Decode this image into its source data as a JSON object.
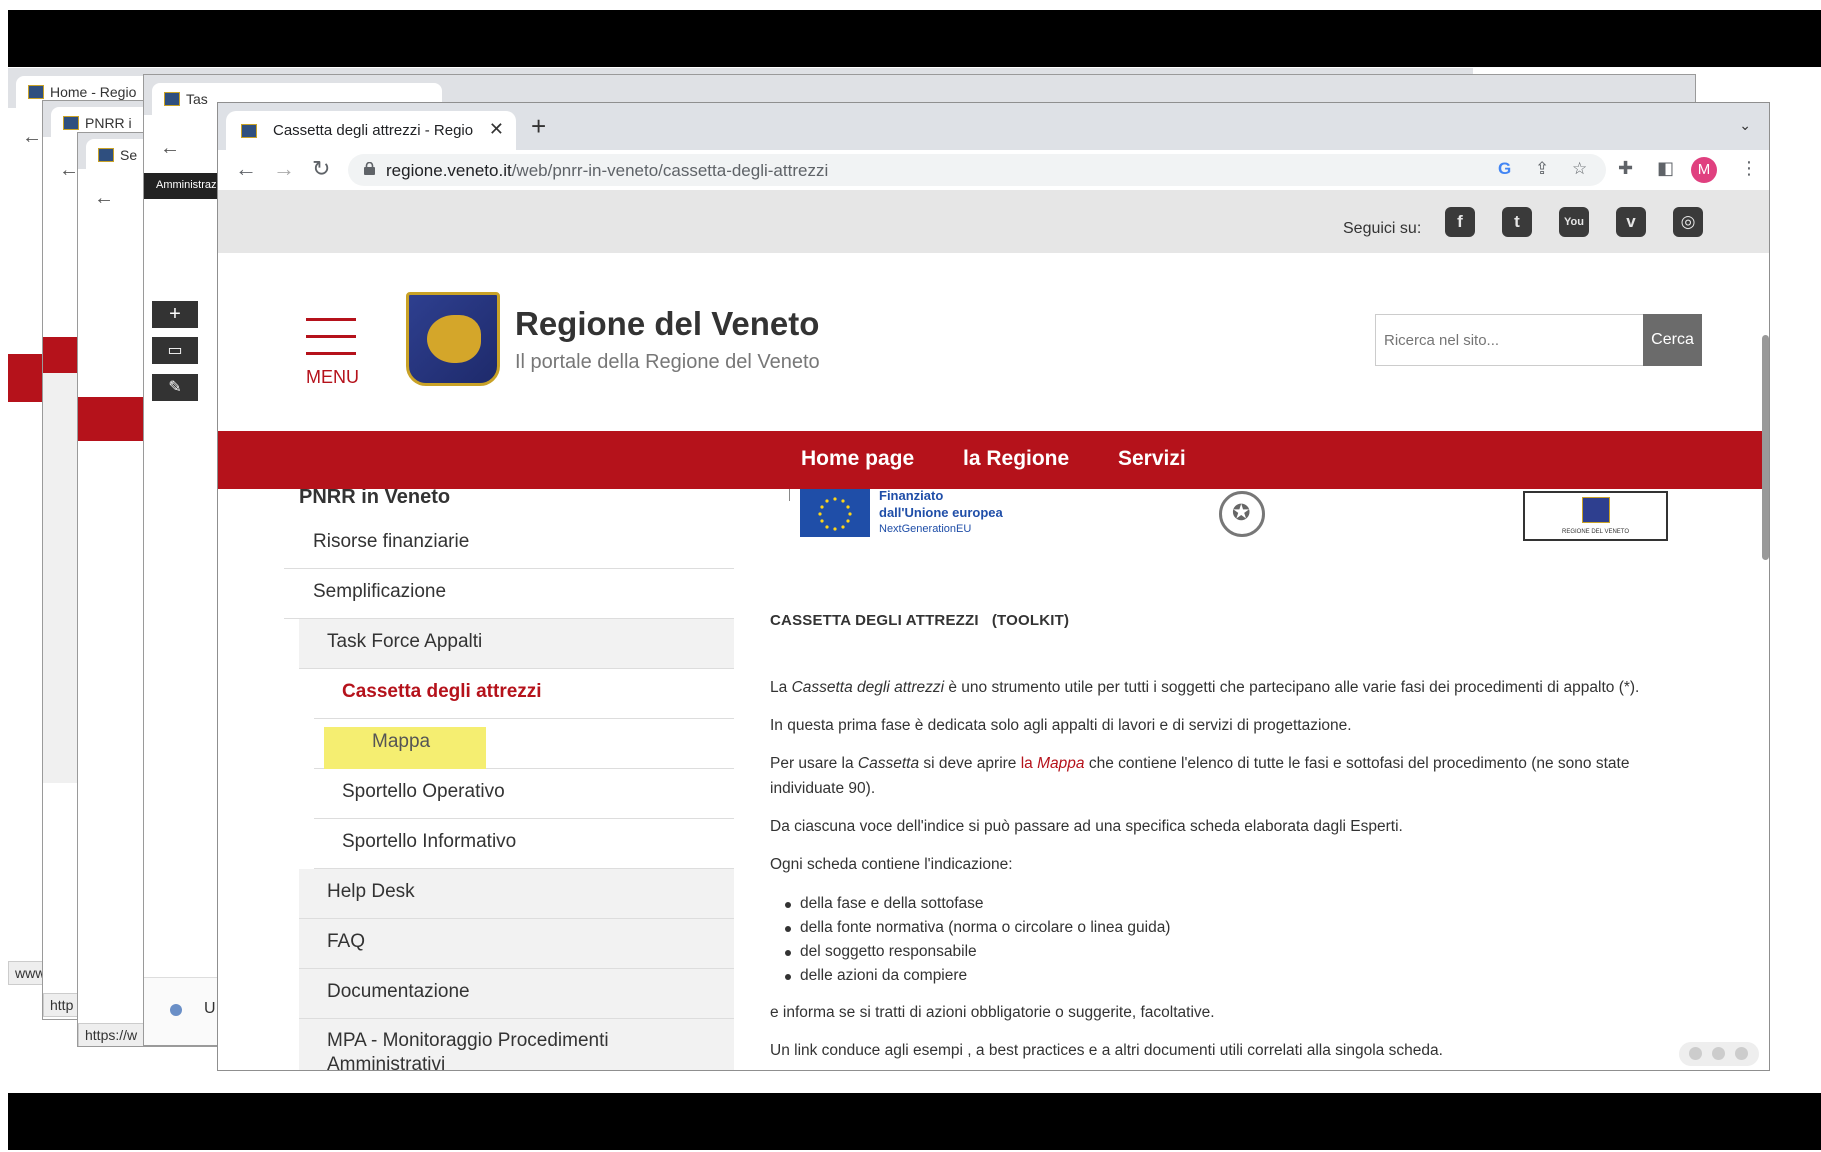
{
  "background_windows": {
    "tab1_title": "Home - Regio",
    "tab2_title": "PNRR i",
    "tab3_title": "Se",
    "tab4_title": "Tas",
    "amministrazione_label": "Amministraz",
    "status1": "www",
    "status2": "http",
    "status3": "https://w",
    "status4": "U"
  },
  "browser": {
    "tab_title": "Cassetta degli attrezzi - Regio",
    "url_domain": "regione.veneto.it",
    "url_path": "/web/pnrr-in-veneto/cassetta-degli-attrezzi",
    "profile_initial": "M"
  },
  "social": {
    "label": "Seguici su:",
    "icons": [
      "facebook-icon",
      "twitter-icon",
      "youtube-icon",
      "vimeo-icon",
      "instagram-icon"
    ]
  },
  "header": {
    "menu_label": "MENU",
    "title": "Regione del Veneto",
    "subtitle": "Il portale della Regione del Veneto",
    "search_placeholder": "Ricerca nel sito...",
    "search_button": "Cerca"
  },
  "nav": {
    "items": [
      "Home page",
      "la Regione",
      "Servizi"
    ]
  },
  "sidebar": {
    "heading": "PNRR in Veneto",
    "items": [
      {
        "label": "Risorse finanziarie"
      },
      {
        "label": "Semplificazione"
      },
      {
        "label": "Task Force Appalti"
      },
      {
        "label": "Cassetta degli attrezzi"
      },
      {
        "label": "Mappa"
      },
      {
        "label": "Sportello Operativo"
      },
      {
        "label": "Sportello Informativo"
      },
      {
        "label": "Help Desk"
      },
      {
        "label": "FAQ"
      },
      {
        "label": "Documentazione"
      },
      {
        "label": "MPA - Monitoraggio Procedimenti Amministrativi"
      }
    ]
  },
  "logos": {
    "eu_line1": "Finanziato",
    "eu_line2": "dall'Unione europea",
    "eu_line3": "NextGenerationEU",
    "regione_caption": "REGIONE DEL VENETO"
  },
  "content": {
    "title": "CASSETTA DEGLI ATTREZZI   (TOOLKIT)",
    "p1_a": "La ",
    "p1_em": "Cassetta degli attrezzi",
    "p1_b": " è uno strumento utile per tutti i soggetti che partecipano alle varie fasi dei procedimenti di appalto (*).",
    "p2": "In questa prima fase è dedicata solo agli appalti di lavori e di servizi di progettazione.",
    "p3_a": "Per usare la ",
    "p3_em": "Cassetta",
    "p3_b": " si deve aprire ",
    "p3_link_a": "la ",
    "p3_link_em": "Mappa",
    "p3_c": " che contiene l'elenco di tutte le fasi e sottofasi del procedimento (ne sono state individuate 90).",
    "p4": "Da ciascuna voce dell'indice si può passare ad una specifica scheda elaborata dagli Esperti.",
    "p5": "Ogni scheda contiene l'indicazione:",
    "bullets": [
      "della fase e della sottofase",
      "della fonte normativa (norma o circolare o linea guida)",
      "del soggetto responsabile",
      "delle azioni da compiere"
    ],
    "p6": "e informa se si tratti di azioni obbligatorie o suggerite, facoltative.",
    "p7": "Un link conduce agli esempi , a best practices e a altri documenti utili correlati alla singola scheda."
  }
}
